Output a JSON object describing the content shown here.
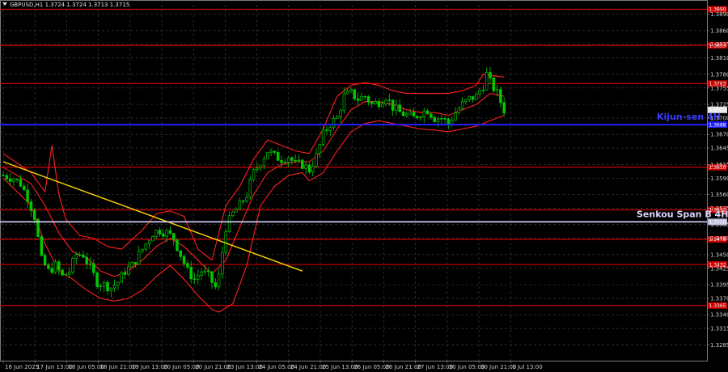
{
  "header": {
    "arrow_icon": "triangle-down-icon",
    "text": "GBPUSD,H1  1.3724 1.3724 1.3713 1.3715"
  },
  "colors": {
    "background": "#000000",
    "grid": "#3a3a3a",
    "candle_body": "#00c800",
    "candle_wick": "#00c800",
    "bollinger": "#ff2020",
    "trendline": "#ffd700",
    "level_line": "#cc0000",
    "kijun": "#2020ff",
    "senkou": "#d8d8ff",
    "axis_text": "#cfcfcf"
  },
  "chart_data": {
    "type": "candlestick",
    "symbol": "GBPUSD",
    "timeframe": "H1",
    "ylim": [
      1.3256,
      1.3916
    ],
    "y_ticks": [
      "1.3890",
      "1.3860",
      "1.3835",
      "1.3810",
      "1.3780",
      "1.3755",
      "1.3725",
      "1.3700",
      "1.3670",
      "1.3645",
      "1.3615",
      "1.3590",
      "1.3560",
      "1.3535",
      "1.3505",
      "1.3480",
      "1.3450",
      "1.3425",
      "1.3395",
      "1.3370",
      "1.3340",
      "1.3315",
      "1.3285"
    ],
    "x_ticks": [
      "16 Jun 2025",
      "17 Jun 13:00",
      "18 Jun 05:00",
      "18 Jun 21:00",
      "19 Jun 13:00",
      "20 Jun 05:00",
      "20 Jun 21:00",
      "23 Jun 13:00",
      "24 Jun 05:00",
      "24 Jun 21:00",
      "25 Jun 13:00",
      "26 Jun 05:00",
      "26 Jun 21:00",
      "27 Jun 13:00",
      "30 Jun 05:00",
      "30 Jun 21:00",
      "1 Jul 13:00"
    ],
    "levels": [
      {
        "label": "1.3890",
        "value": 1.3899
      },
      {
        "label": "1.3833",
        "value": 1.3833
      },
      {
        "label": "1.3763",
        "value": 1.3763
      },
      {
        "label": "1.3610",
        "value": 1.361
      },
      {
        "label": "1.3532",
        "value": 1.3532
      },
      {
        "label": "1.3478",
        "value": 1.3478
      },
      {
        "label": "1.3432",
        "value": 1.3432
      },
      {
        "label": "1.3365",
        "value": 1.3357
      }
    ],
    "kijun": {
      "label": "Kijun-sen 4H",
      "value": 1.3688,
      "badge": "1.3688"
    },
    "senkou": {
      "label": "Senkou Span B 4H",
      "value": 1.351,
      "badge": "1.3510"
    },
    "current_price": "1.3715",
    "current_value": 1.3715,
    "trendline": {
      "start": {
        "x": 0,
        "y": 1.362
      },
      "end": {
        "x": 86,
        "y": 1.342
      }
    },
    "close_path": [
      [
        0,
        1.3595
      ],
      [
        3,
        1.359
      ],
      [
        5,
        1.358
      ],
      [
        7,
        1.3555
      ],
      [
        9,
        1.352
      ],
      [
        11,
        1.344
      ],
      [
        13,
        1.342
      ],
      [
        15,
        1.343
      ],
      [
        17,
        1.341
      ],
      [
        19,
        1.342
      ],
      [
        21,
        1.345
      ],
      [
        23,
        1.345
      ],
      [
        25,
        1.3425
      ],
      [
        27,
        1.34
      ],
      [
        29,
        1.3395
      ],
      [
        31,
        1.339
      ],
      [
        33,
        1.34
      ],
      [
        35,
        1.342
      ],
      [
        37,
        1.343
      ],
      [
        39,
        1.345
      ],
      [
        41,
        1.347
      ],
      [
        43,
        1.349
      ],
      [
        45,
        1.3495
      ],
      [
        47,
        1.349
      ],
      [
        49,
        1.348
      ],
      [
        51,
        1.345
      ],
      [
        53,
        1.342
      ],
      [
        55,
        1.3405
      ],
      [
        57,
        1.342
      ],
      [
        59,
        1.341
      ],
      [
        61,
        1.339
      ],
      [
        62,
        1.341
      ],
      [
        64,
        1.35
      ],
      [
        66,
        1.3525
      ],
      [
        68,
        1.354
      ],
      [
        70,
        1.356
      ],
      [
        72,
        1.36
      ],
      [
        74,
        1.362
      ],
      [
        76,
        1.364
      ],
      [
        78,
        1.363
      ],
      [
        80,
        1.3625
      ],
      [
        82,
        1.363
      ],
      [
        84,
        1.3615
      ],
      [
        86,
        1.3615
      ],
      [
        88,
        1.3605
      ],
      [
        90,
        1.363
      ],
      [
        92,
        1.367
      ],
      [
        94,
        1.369
      ],
      [
        96,
        1.37
      ],
      [
        98,
        1.374
      ],
      [
        100,
        1.3745
      ],
      [
        102,
        1.3735
      ],
      [
        104,
        1.374
      ],
      [
        106,
        1.3725
      ],
      [
        108,
        1.373
      ],
      [
        110,
        1.374
      ],
      [
        112,
        1.372
      ],
      [
        114,
        1.371
      ],
      [
        116,
        1.3705
      ],
      [
        118,
        1.37
      ],
      [
        120,
        1.371
      ],
      [
        122,
        1.3715
      ],
      [
        124,
        1.37
      ],
      [
        126,
        1.37
      ],
      [
        128,
        1.369
      ],
      [
        130,
        1.371
      ],
      [
        132,
        1.3725
      ],
      [
        134,
        1.3735
      ],
      [
        136,
        1.374
      ],
      [
        138,
        1.376
      ],
      [
        139,
        1.378
      ],
      [
        140,
        1.3765
      ],
      [
        142,
        1.3745
      ],
      [
        143,
        1.373
      ],
      [
        144,
        1.3715
      ]
    ],
    "bollinger": {
      "upper": [
        [
          0,
          1.3635
        ],
        [
          8,
          1.36
        ],
        [
          12,
          1.3565
        ],
        [
          14,
          1.365
        ],
        [
          16,
          1.356
        ],
        [
          18,
          1.3515
        ],
        [
          22,
          1.3485
        ],
        [
          26,
          1.348
        ],
        [
          30,
          1.3465
        ],
        [
          34,
          1.346
        ],
        [
          40,
          1.3495
        ],
        [
          44,
          1.3525
        ],
        [
          48,
          1.353
        ],
        [
          52,
          1.352
        ],
        [
          56,
          1.346
        ],
        [
          60,
          1.344
        ],
        [
          64,
          1.354
        ],
        [
          68,
          1.3575
        ],
        [
          72,
          1.3625
        ],
        [
          76,
          1.366
        ],
        [
          80,
          1.365
        ],
        [
          84,
          1.364
        ],
        [
          88,
          1.3635
        ],
        [
          92,
          1.368
        ],
        [
          96,
          1.374
        ],
        [
          100,
          1.376
        ],
        [
          104,
          1.3765
        ],
        [
          108,
          1.376
        ],
        [
          112,
          1.375
        ],
        [
          116,
          1.3745
        ],
        [
          120,
          1.3745
        ],
        [
          124,
          1.3745
        ],
        [
          128,
          1.3745
        ],
        [
          132,
          1.375
        ],
        [
          136,
          1.376
        ],
        [
          138,
          1.378
        ],
        [
          144,
          1.3775
        ]
      ],
      "middle": [
        [
          0,
          1.361
        ],
        [
          8,
          1.358
        ],
        [
          12,
          1.354
        ],
        [
          16,
          1.349
        ],
        [
          20,
          1.3455
        ],
        [
          24,
          1.3445
        ],
        [
          28,
          1.342
        ],
        [
          32,
          1.341
        ],
        [
          36,
          1.342
        ],
        [
          40,
          1.344
        ],
        [
          44,
          1.3465
        ],
        [
          48,
          1.348
        ],
        [
          52,
          1.3465
        ],
        [
          56,
          1.344
        ],
        [
          60,
          1.3415
        ],
        [
          64,
          1.344
        ],
        [
          68,
          1.35
        ],
        [
          72,
          1.356
        ],
        [
          76,
          1.36
        ],
        [
          80,
          1.3615
        ],
        [
          84,
          1.362
        ],
        [
          88,
          1.362
        ],
        [
          92,
          1.364
        ],
        [
          96,
          1.368
        ],
        [
          100,
          1.3715
        ],
        [
          104,
          1.373
        ],
        [
          108,
          1.373
        ],
        [
          112,
          1.3725
        ],
        [
          116,
          1.3715
        ],
        [
          120,
          1.371
        ],
        [
          124,
          1.371
        ],
        [
          128,
          1.3705
        ],
        [
          132,
          1.3715
        ],
        [
          136,
          1.3725
        ],
        [
          140,
          1.3745
        ],
        [
          144,
          1.374
        ]
      ],
      "lower": [
        [
          0,
          1.359
        ],
        [
          8,
          1.354
        ],
        [
          12,
          1.347
        ],
        [
          16,
          1.342
        ],
        [
          20,
          1.3405
        ],
        [
          24,
          1.3385
        ],
        [
          28,
          1.337
        ],
        [
          32,
          1.3365
        ],
        [
          36,
          1.337
        ],
        [
          40,
          1.3385
        ],
        [
          44,
          1.341
        ],
        [
          48,
          1.343
        ],
        [
          52,
          1.3405
        ],
        [
          56,
          1.3375
        ],
        [
          60,
          1.335
        ],
        [
          62,
          1.3345
        ],
        [
          66,
          1.336
        ],
        [
          70,
          1.343
        ],
        [
          74,
          1.354
        ],
        [
          78,
          1.3575
        ],
        [
          82,
          1.3595
        ],
        [
          86,
          1.36
        ],
        [
          88,
          1.3585
        ],
        [
          92,
          1.36
        ],
        [
          96,
          1.364
        ],
        [
          100,
          1.3675
        ],
        [
          104,
          1.369
        ],
        [
          108,
          1.3695
        ],
        [
          112,
          1.369
        ],
        [
          116,
          1.3685
        ],
        [
          120,
          1.368
        ],
        [
          124,
          1.3678
        ],
        [
          128,
          1.3675
        ],
        [
          132,
          1.368
        ],
        [
          136,
          1.3685
        ],
        [
          140,
          1.3695
        ],
        [
          144,
          1.3705
        ]
      ]
    }
  }
}
